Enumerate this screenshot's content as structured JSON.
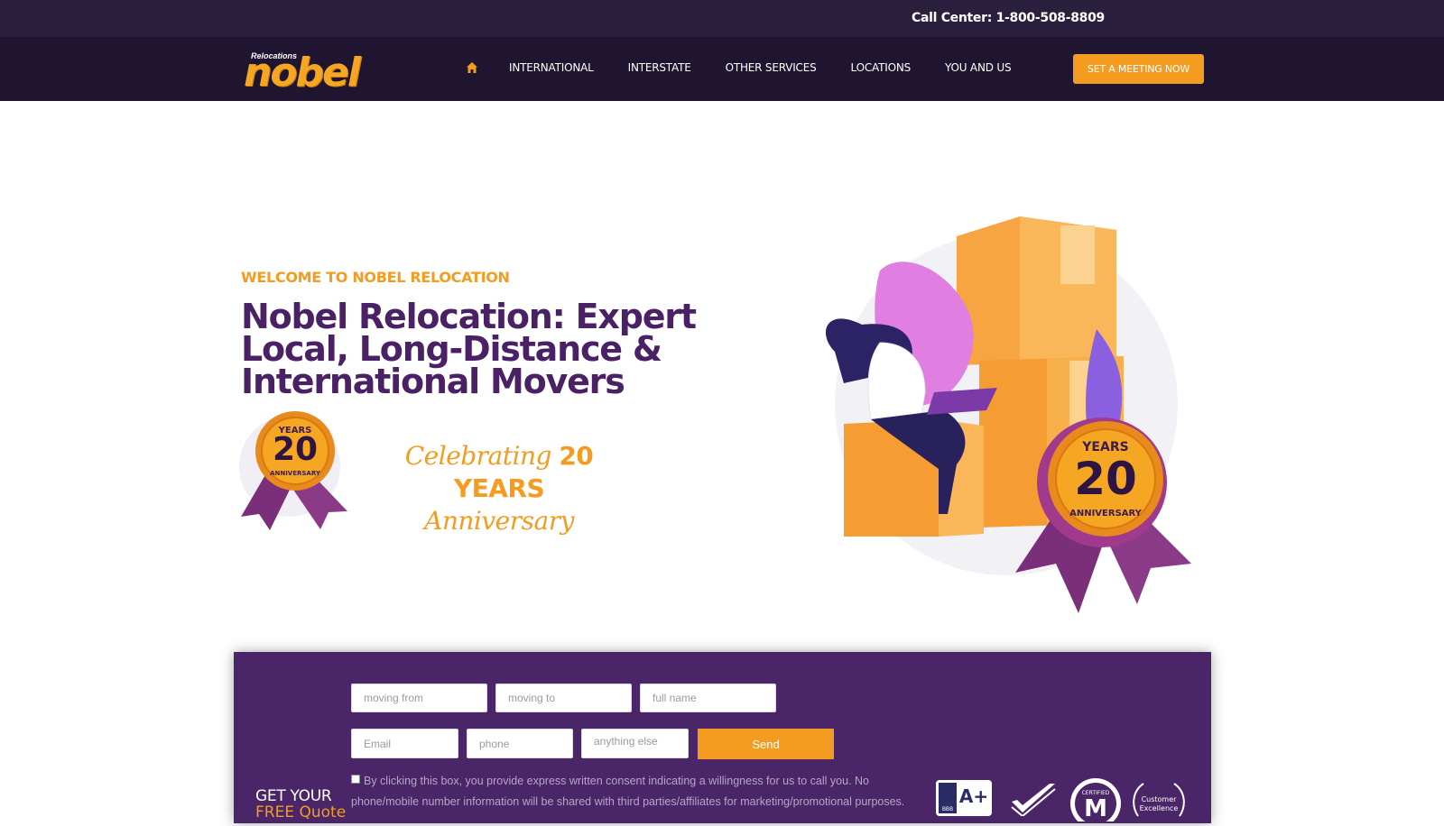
{
  "topbar": {
    "call_center": "Call Center: 1-800-508-8809"
  },
  "logo": {
    "small": "Relocations",
    "big": "nobel"
  },
  "nav": {
    "home_icon": "home-icon",
    "items": [
      "INTERNATIONAL",
      "INTERSTATE",
      "OTHER SERVICES",
      "LOCATIONS",
      "YOU AND US"
    ],
    "cta": "SET A MEETING NOW"
  },
  "hero": {
    "eyebrow": "WELCOME TO NOBEL RELOCATION",
    "headline": "Nobel Relocation: Expert Local, Long-Distance & International Movers",
    "badge_small": {
      "top": "YEARS",
      "number": "20",
      "bottom": "ANNIVERSARY"
    },
    "celebrate_prefix": "Celebrating ",
    "celebrate_strong": "20 YEARS",
    "celebrate_suffix": "Anniversary",
    "badge_large": {
      "top": "YEARS",
      "number": "20",
      "bottom": "ANNIVERSARY"
    }
  },
  "quote_form": {
    "moving_from": "moving from",
    "moving_to": "moving to",
    "full_name": "full name",
    "email": "Email",
    "phone": "phone",
    "anything_else": "anything else",
    "send": "Send",
    "consent": "By clicking this box, you provide express written consent indicating a willingness for us to call you. No phone/mobile number information will be shared with third parties/affiliates for marketing/promotional purposes.",
    "get_your": "GET YOUR",
    "free_quote": "FREE Quote",
    "cert_bbb": "A+",
    "cert_bbb_small": "BBB",
    "cert_certified": "CERTIFIED",
    "cert_customer": "Customer",
    "cert_excellence": "Excellence"
  },
  "colors": {
    "accent": "#f39c20",
    "purple": "#4b2166",
    "dark": "#1f1530"
  }
}
